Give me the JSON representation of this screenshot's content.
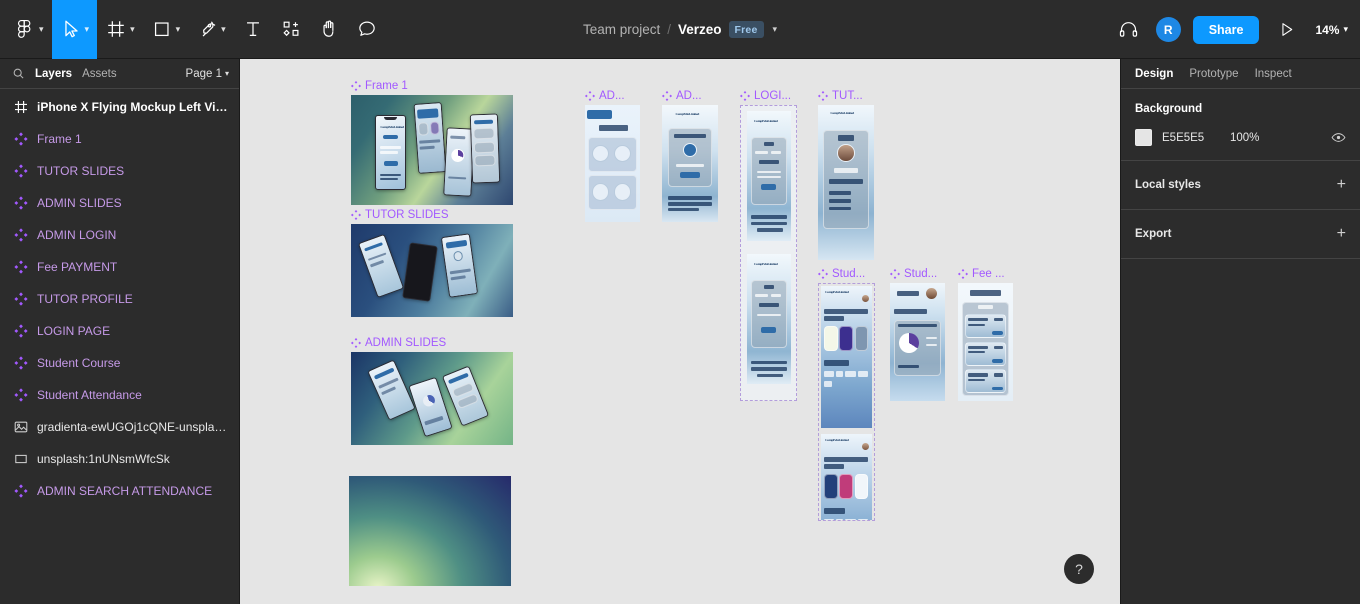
{
  "toolbar": {
    "tools": [
      {
        "name": "figma-menu-icon",
        "icon": "figma",
        "caret": true,
        "active": false
      },
      {
        "name": "move-tool",
        "icon": "cursor",
        "caret": true,
        "active": true
      },
      {
        "name": "frame-tool",
        "icon": "frame",
        "caret": true,
        "active": false
      },
      {
        "name": "shape-tool",
        "icon": "square",
        "caret": true,
        "active": false
      },
      {
        "name": "pen-tool",
        "icon": "pen",
        "caret": true,
        "active": false
      },
      {
        "name": "text-tool",
        "icon": "text",
        "caret": false,
        "active": false
      },
      {
        "name": "resources-tool",
        "icon": "resources",
        "caret": false,
        "active": false
      },
      {
        "name": "hand-tool",
        "icon": "hand",
        "caret": false,
        "active": false
      },
      {
        "name": "comment-tool",
        "icon": "comment",
        "caret": false,
        "active": false
      }
    ],
    "breadcrumb": {
      "team": "Team project",
      "separator": "/",
      "file": "Verzeo",
      "plan_badge": "Free"
    },
    "right": {
      "headphones_icon": "headphones-icon",
      "avatar_initial": "R",
      "share_label": "Share",
      "present_icon": "play-icon",
      "zoom_level": "14%"
    },
    "accent_color": "#0d99ff"
  },
  "left_panel": {
    "search_icon": "search-icon",
    "tabs": [
      {
        "label": "Layers",
        "active": true
      },
      {
        "label": "Assets",
        "active": false
      }
    ],
    "page_selector": "Page 1",
    "layers": [
      {
        "name": "iPhone X Flying Mockup Left View",
        "type": "frame"
      },
      {
        "name": "Frame 1",
        "type": "component"
      },
      {
        "name": "TUTOR SLIDES",
        "type": "component"
      },
      {
        "name": "ADMIN SLIDES",
        "type": "component"
      },
      {
        "name": "ADMIN LOGIN",
        "type": "component"
      },
      {
        "name": "Fee PAYMENT",
        "type": "component"
      },
      {
        "name": "TUTOR PROFILE",
        "type": "component"
      },
      {
        "name": "LOGIN PAGE",
        "type": "component"
      },
      {
        "name": "Student Course",
        "type": "component"
      },
      {
        "name": "Student Attendance",
        "type": "component"
      },
      {
        "name": "gradienta-ewUGOj1cQNE-unsplas...",
        "type": "image"
      },
      {
        "name": "unsplash:1nUNsmWfcSk",
        "type": "rect"
      },
      {
        "name": "ADMIN SEARCH ATTENDANCE",
        "type": "component"
      }
    ]
  },
  "canvas": {
    "background_color": "#E5E5E5",
    "help_button": "?",
    "frames": [
      {
        "label": "Frame 1",
        "kind": "component"
      },
      {
        "label": "TUTOR SLIDES",
        "kind": "component"
      },
      {
        "label": "ADMIN SLIDES",
        "kind": "component"
      },
      {
        "label": "AD...",
        "kind": "component"
      },
      {
        "label": "AD...",
        "kind": "component"
      },
      {
        "label": "LOGI...",
        "kind": "component"
      },
      {
        "label": "TUT...",
        "kind": "component"
      },
      {
        "label": "Stud...",
        "kind": "component"
      },
      {
        "label": "Stud...",
        "kind": "component"
      },
      {
        "label": "Fee ...",
        "kind": "component"
      }
    ],
    "thumbnail_text": {
      "admin_badge": "ADMIN",
      "attendance_title": "ATTENDANCE",
      "tutors_label": "TUTORS",
      "students_label": "STUDENTS",
      "welcome_admin": "WELCOME BACK ADMIN",
      "login_title": "LOGIN",
      "welcome_back": "WELCOME BACK",
      "login_now": "LOGIN NOW",
      "tutor_title": "TUTOR",
      "brand": "CompEduLimited",
      "course_heading": "MOST POPULAR COMPUTER COURSES",
      "hot_topics": "HOT TOPICS !",
      "attendance_heading": "COURSE ATTENDANCE",
      "fee_month": "AUGUST 2022",
      "fee_title": "FEE",
      "fee_items": [
        {
          "course": "LINUX DESIGNER",
          "amount": "25$"
        },
        {
          "course": "WEB DEVELOPER",
          "amount": "30$"
        },
        {
          "course": "JAVA PROGRAMMING",
          "amount": "25$"
        }
      ]
    }
  },
  "right_panel": {
    "tabs": [
      {
        "label": "Design",
        "active": true
      },
      {
        "label": "Prototype",
        "active": false
      },
      {
        "label": "Inspect",
        "active": false
      }
    ],
    "background": {
      "title": "Background",
      "hex": "E5E5E5",
      "opacity": "100%",
      "visibility_icon": "eye-icon"
    },
    "local_styles": {
      "label": "Local styles",
      "add_icon": "plus-icon"
    },
    "export": {
      "label": "Export",
      "add_icon": "plus-icon"
    }
  }
}
